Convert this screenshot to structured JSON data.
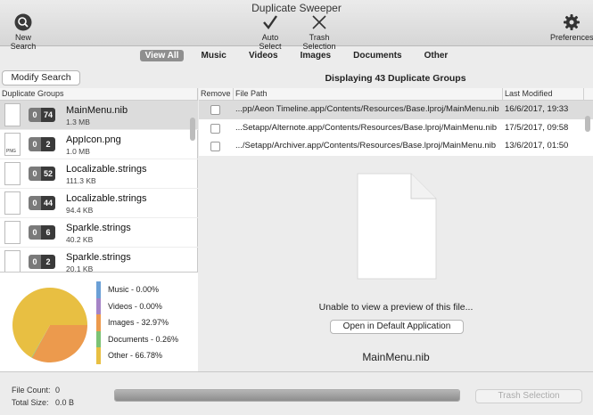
{
  "window": {
    "title": "Duplicate Sweeper"
  },
  "toolbar": {
    "new_search": "New Search",
    "auto_select": "Auto Select",
    "trash_selection": "Trash Selection",
    "preferences": "Preferences"
  },
  "filters": [
    {
      "label": "View All",
      "active": true
    },
    {
      "label": "Music",
      "active": false
    },
    {
      "label": "Videos",
      "active": false
    },
    {
      "label": "Images",
      "active": false
    },
    {
      "label": "Documents",
      "active": false
    },
    {
      "label": "Other",
      "active": false
    }
  ],
  "search": {
    "modify_label": "Modify Search",
    "displaying": "Displaying 43 Duplicate Groups"
  },
  "left": {
    "header": "Duplicate Groups",
    "groups": [
      {
        "icon": "file-icon",
        "zero": "0",
        "count": "74",
        "name": "MainMenu.nib",
        "size": "1.3 MB"
      },
      {
        "icon": "png-file-icon",
        "zero": "0",
        "count": "2",
        "name": "AppIcon.png",
        "size": "1.0 MB"
      },
      {
        "icon": "file-icon",
        "zero": "0",
        "count": "52",
        "name": "Localizable.strings",
        "size": "111.3 KB"
      },
      {
        "icon": "file-icon",
        "zero": "0",
        "count": "44",
        "name": "Localizable.strings",
        "size": "94.4 KB"
      },
      {
        "icon": "file-icon",
        "zero": "0",
        "count": "6",
        "name": "Sparkle.strings",
        "size": "40.2 KB"
      },
      {
        "icon": "file-icon",
        "zero": "0",
        "count": "2",
        "name": "Sparkle.strings",
        "size": "20.1 KB"
      }
    ]
  },
  "chart_data": {
    "type": "pie",
    "slices": [
      {
        "label": "Music - 0.00%",
        "value": 0.0,
        "color": "#6ba0d6"
      },
      {
        "label": "Videos - 0.00%",
        "value": 0.0,
        "color": "#a584c6"
      },
      {
        "label": "Images - 32.97%",
        "value": 32.97,
        "color": "#ec9a4d"
      },
      {
        "label": "Documents - 0.26%",
        "value": 0.26,
        "color": "#7cc274"
      },
      {
        "label": "Other - 66.78%",
        "value": 66.78,
        "color": "#e8bf42"
      }
    ]
  },
  "table": {
    "headers": {
      "remove": "Remove",
      "path": "File Path",
      "modified": "Last Modified"
    },
    "rows": [
      {
        "path": "...pp/Aeon Timeline.app/Contents/Resources/Base.lproj/MainMenu.nib",
        "modified": "16/6/2017, 19:33"
      },
      {
        "path": "...Setapp/Alternote.app/Contents/Resources/Base.lproj/MainMenu.nib",
        "modified": "17/5/2017, 09:58"
      },
      {
        "path": ".../Setapp/Archiver.app/Contents/Resources/Base.lproj/MainMenu.nib",
        "modified": "13/6/2017, 01:50"
      }
    ]
  },
  "preview": {
    "message": "Unable to view a preview of this file...",
    "open_label": "Open in Default Application",
    "filename": "MainMenu.nib"
  },
  "bottom": {
    "file_count_label": "File Count:",
    "file_count": "0",
    "total_size_label": "Total Size:",
    "total_size": "0.0 B",
    "progress": 1.0,
    "trash_label": "Trash Selection"
  }
}
